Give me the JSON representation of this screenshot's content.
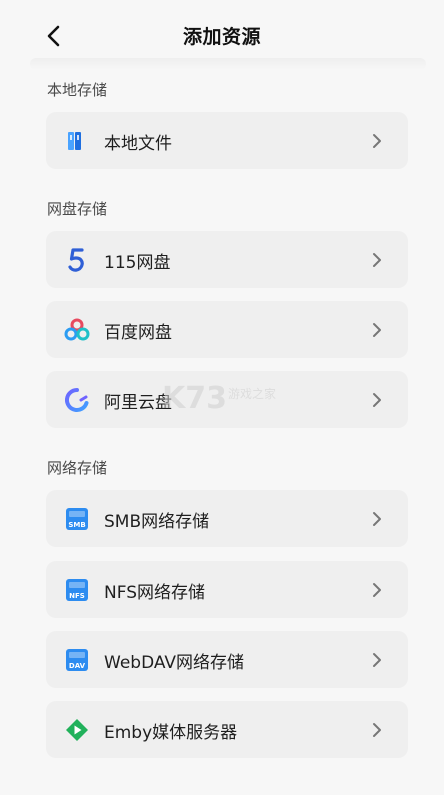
{
  "header": {
    "title": "添加资源"
  },
  "sections": {
    "local": {
      "title": "本地存储"
    },
    "cloud": {
      "title": "网盘存储"
    },
    "network": {
      "title": "网络存储"
    }
  },
  "items": {
    "local_files": {
      "label": "本地文件",
      "icon": "folder-icon"
    },
    "pan115": {
      "label": "115网盘",
      "icon": "number-five-icon"
    },
    "baidu": {
      "label": "百度网盘",
      "icon": "baidu-cloud-icon"
    },
    "aliyun": {
      "label": "阿里云盘",
      "icon": "aliyun-drive-icon"
    },
    "smb": {
      "label": "SMB网络存储",
      "icon": "smb-server-icon"
    },
    "nfs": {
      "label": "NFS网络存储",
      "icon": "nfs-server-icon"
    },
    "webdav": {
      "label": "WebDAV网络存储",
      "icon": "dav-server-icon"
    },
    "emby": {
      "label": "Emby媒体服务器",
      "icon": "emby-play-icon"
    }
  },
  "watermark": {
    "text": "K73",
    "subtitle": "游戏之家"
  },
  "colors": {
    "background": "#f7f7f7",
    "card": "#efefef",
    "accent_blue": "#3b82f6",
    "emby_green": "#21b15b"
  }
}
